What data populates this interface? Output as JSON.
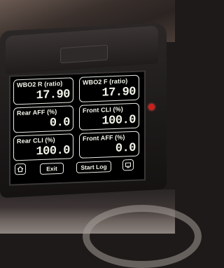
{
  "gauges": [
    {
      "label": "WBO2 R (ratio)",
      "value": "17.90"
    },
    {
      "label": "WBO2 F (ratio)",
      "value": "17.90"
    },
    {
      "label": "Rear AFF (%)",
      "value": "0.0"
    },
    {
      "label": "Front CLI (%)",
      "value": "100.0"
    },
    {
      "label": "Rear CLI (%)",
      "value": "100.0"
    },
    {
      "label": "Front AFF (%)",
      "value": "0.0"
    }
  ],
  "buttons": {
    "exit_label": "Exit",
    "start_log_label": "Start Log"
  },
  "icons": {
    "left": "home-icon",
    "right": "screen-icon"
  },
  "colors": {
    "screen_bg": "#000000",
    "text": "#f2f6ea",
    "led": "#c9201c"
  }
}
